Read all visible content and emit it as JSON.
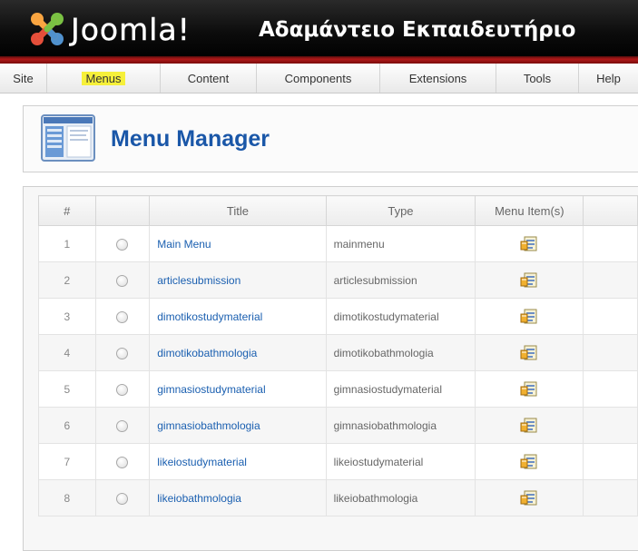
{
  "header": {
    "brand": "Joomla!",
    "site_name": "Αδαμάντειο Εκπαιδευτήριο"
  },
  "menubar": {
    "items": [
      {
        "label": "Site",
        "active": false
      },
      {
        "label": "Menus",
        "active": true
      },
      {
        "label": "Content",
        "active": false
      },
      {
        "label": "Components",
        "active": false
      },
      {
        "label": "Extensions",
        "active": false
      },
      {
        "label": "Tools",
        "active": false
      },
      {
        "label": "Help",
        "active": false
      }
    ]
  },
  "page": {
    "title": "Menu Manager"
  },
  "table": {
    "columns": [
      "#",
      "",
      "Title",
      "Type",
      "Menu Item(s)"
    ],
    "rows": [
      {
        "num": "1",
        "title": "Main Menu",
        "type": "mainmenu"
      },
      {
        "num": "2",
        "title": "articlesubmission",
        "type": "articlesubmission"
      },
      {
        "num": "3",
        "title": "dimotikostudymaterial",
        "type": "dimotikostudymaterial"
      },
      {
        "num": "4",
        "title": "dimotikobathmologia",
        "type": "dimotikobathmologia"
      },
      {
        "num": "5",
        "title": "gimnasiostudymaterial",
        "type": "gimnasiostudymaterial"
      },
      {
        "num": "6",
        "title": "gimnasiobathmologia",
        "type": "gimnasiobathmologia"
      },
      {
        "num": "7",
        "title": "likeiostudymaterial",
        "type": "likeiostudymaterial"
      },
      {
        "num": "8",
        "title": "likeiobathmologia",
        "type": "likeiobathmologia"
      }
    ]
  },
  "colors": {
    "accent_link": "#1a5fb0",
    "title_blue": "#1a57a8",
    "active_highlight": "#f6f03a",
    "header_red": "#b01818"
  },
  "icons": {
    "logo": "joomla-logo-icon",
    "manager": "menu-manager-icon",
    "menu_items": "menu-items-icon"
  }
}
